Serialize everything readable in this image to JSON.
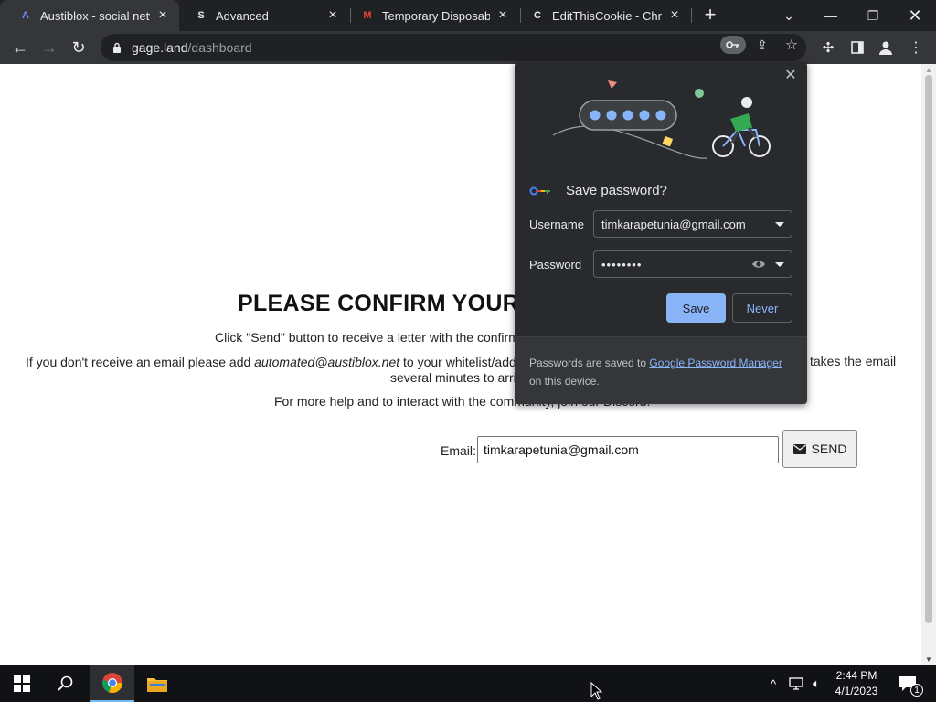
{
  "tabs": [
    {
      "title": "Austiblox - social netw",
      "favicon": "A",
      "favicon_color": "#6b8cff"
    },
    {
      "title": "Advanced",
      "favicon": "S",
      "favicon_color": "#e8eaed"
    },
    {
      "title": "Temporary Disposable",
      "favicon": "M",
      "favicon_color": "#ea4335"
    },
    {
      "title": "EditThisCookie - Chron",
      "favicon": "C",
      "favicon_color": "#e8eaed"
    }
  ],
  "toolbar": {
    "url_host": "gage.land",
    "url_path": "/dashboard"
  },
  "page": {
    "headline": "PLEASE CONFIRM YOUR E",
    "p1": "Click \"Send\" button to receive a letter with the confirm",
    "p2_prefix": "If you don't receive an email please add ",
    "p2_email": "automated@austiblox.net",
    "p2_suffix": " to your whitelist/addr",
    "p2_tail": "takes the email",
    "p2_line2": "several minutes to arri",
    "p3": "For more help and to interact with the community, join our Discord.",
    "email_label": "Email:",
    "email_value": "timkarapetunia@gmail.com",
    "send_label": "SEND"
  },
  "password_bubble": {
    "heading": "Save password?",
    "username_label": "Username",
    "username_value": "timkarapetunia@gmail.com",
    "password_label": "Password",
    "password_value": "••••••••",
    "save_label": "Save",
    "never_label": "Never",
    "footer_prefix": "Passwords are saved to ",
    "footer_link": "Google Password Manager",
    "footer_suffix": " on this device."
  },
  "taskbar": {
    "time": "2:44 PM",
    "date": "4/1/2023",
    "notification_count": "1"
  },
  "colors": {
    "accent_blue": "#8ab4f8",
    "chrome_dark": "#202124",
    "toolbar_gray": "#35363a"
  }
}
